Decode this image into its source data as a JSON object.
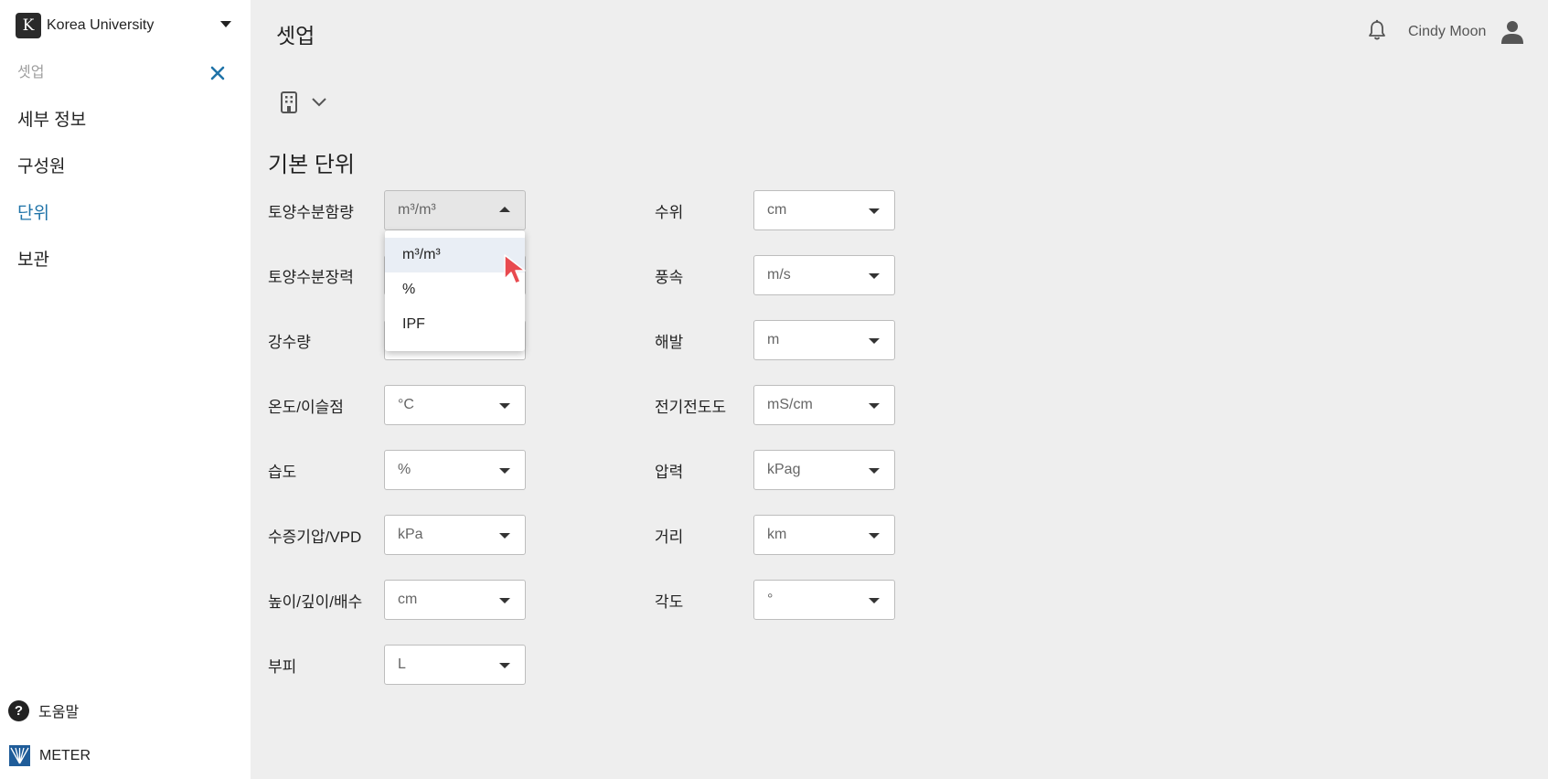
{
  "sidebar": {
    "org": {
      "logo_letter": "K",
      "name": "Korea University"
    },
    "section_title": "셋업",
    "items": [
      {
        "label": "세부 정보",
        "active": false
      },
      {
        "label": "구성원",
        "active": false
      },
      {
        "label": "단위",
        "active": true
      },
      {
        "label": "보관",
        "active": false
      }
    ],
    "help_label": "도움말",
    "brand_label": "METER"
  },
  "header": {
    "title": "셋업",
    "user_name": "Cindy Moon"
  },
  "units": {
    "section_title": "기본 단위",
    "left": [
      {
        "label": "토양수분함량",
        "value": "m³/m³"
      },
      {
        "label": "토양수분장력",
        "value": ""
      },
      {
        "label": "강수량",
        "value": ""
      },
      {
        "label": "온도/이슬점",
        "value": "°C"
      },
      {
        "label": "습도",
        "value": "%"
      },
      {
        "label": "수증기압/VPD",
        "value": "kPa"
      },
      {
        "label": "높이/깊이/배수",
        "value": "cm"
      },
      {
        "label": "부피",
        "value": "L"
      }
    ],
    "right": [
      {
        "label": "수위",
        "value": "cm"
      },
      {
        "label": "풍속",
        "value": "m/s"
      },
      {
        "label": "해발",
        "value": "m"
      },
      {
        "label": "전기전도도",
        "value": "mS/cm"
      },
      {
        "label": "압력",
        "value": "kPag"
      },
      {
        "label": "거리",
        "value": "km"
      },
      {
        "label": "각도",
        "value": "°"
      }
    ]
  },
  "dropdown": {
    "options": [
      "m³/m³",
      "%",
      "IPF"
    ],
    "selected_index": 0
  },
  "colors": {
    "accent": "#1f73a8",
    "sidebar_bg": "#ffffff",
    "main_bg": "#eeeeee"
  }
}
